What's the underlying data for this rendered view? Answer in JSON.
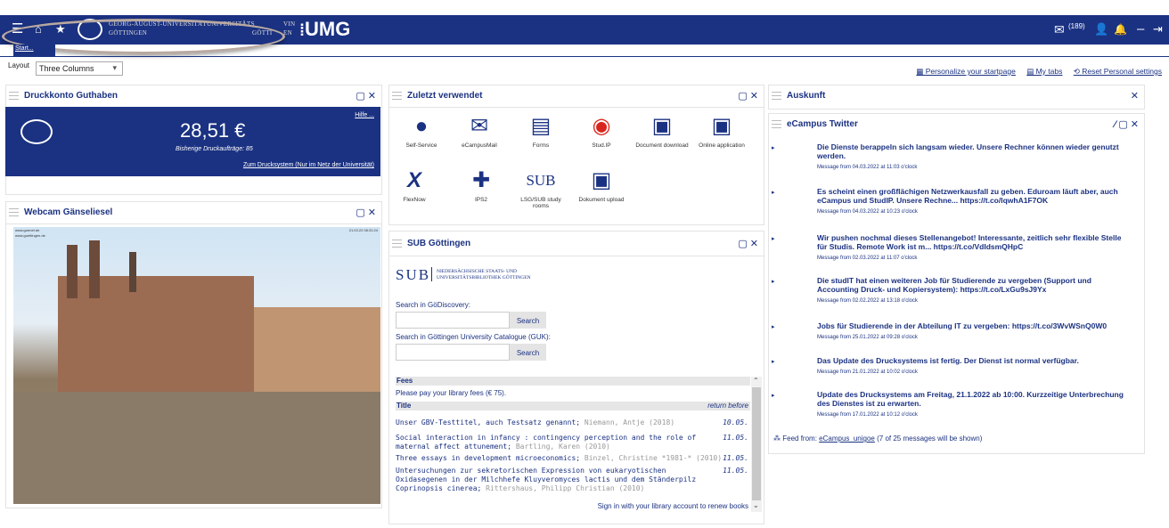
{
  "header": {
    "uni_line1": "GEORG-AUGUST-UNIVERSITÄT",
    "uni_line2": "GÖTTINGEN",
    "uni_right1": "UNIVERSITÄTS",
    "uni_right2": "GÖTTI",
    "uni_right3": "VIN",
    "uni_right4": "EN",
    "brand": "UMG",
    "mail_count": "(189)"
  },
  "tab": {
    "label": "Start..."
  },
  "layout": {
    "label": "Layout",
    "value": "Three Columns"
  },
  "links": {
    "personalize": "Personalize your startpage",
    "mytabs": "My tabs",
    "reset": "Reset Personal settings"
  },
  "druck": {
    "title": "Druckkonto Guthaben",
    "help": "Hilfe ...",
    "balance": "28,51 €",
    "jobs": "Bisherige Druckaufträge: 85",
    "link": "Zum Drucksystem (Nur im Netz der Universität)"
  },
  "webcam": {
    "title": "Webcam Gänseliesel",
    "tl1": "www.goenet.de",
    "tl2": "www.goettingen.de",
    "tr": "21.03.22 08:31:24"
  },
  "zuletzt": {
    "title": "Zuletzt verwendet",
    "items": [
      "Self-Service",
      "eCampusMail",
      "Forms",
      "Stud.IP",
      "Document download",
      "Online application",
      "FlexNow",
      "IPS2",
      "LSG/SUB study rooms",
      "Dokument upload"
    ]
  },
  "sub": {
    "title": "SUB Göttingen",
    "logo": "SUB",
    "logo_text1": "NIEDERSÄCHSISCHE STAATS- UND",
    "logo_text2": "UNIVERSITÄTSBIBLIOTHEK GÖTTINGEN",
    "search1_label": "Search in GöDiscovery:",
    "search2_label": "Search in Göttingen University Catalogue (GUK):",
    "search_btn": "Search",
    "fees_title": "Fees",
    "fees_text": "Please pay your library fees (€ 75).",
    "col_title": "Title",
    "col_return": "return before",
    "rows": [
      {
        "t": "Unser GBV-Testtitel, auch Testsatz genannt;",
        "a": " Niemann, Antje (2018)",
        "d": "10.05."
      },
      {
        "t": "Social interaction in infancy : contingency perception and the role of maternal affect attunement;",
        "a": " Bartling, Karen (2010)",
        "d": "11.05."
      },
      {
        "t": "Three essays in development microeconomics;",
        "a": " Binzel, Christine *1981-* (2010)",
        "d": "11.05."
      },
      {
        "t": "Untersuchungen zur sekretorischen Expression von eukaryotischen Oxidasegenen in der Milchhefe Kluyveromyces lactis und dem Ständerpilz Coprinopsis cinerea;",
        "a": " Rittershaus, Philipp Christian (2010)",
        "d": "11.05."
      }
    ],
    "signin": "Sign in with your library account to renew books"
  },
  "auskunft": {
    "title": "Auskunft"
  },
  "twitter": {
    "title": "eCampus Twitter",
    "items": [
      {
        "t": "Die Dienste berappeln sich langsam wieder. Unsere Rechner können wieder genutzt werden.",
        "m": "Message from 04.03.2022 at 11:03 o'clock"
      },
      {
        "t": "Es scheint einen großflächigen Netzwerkausfall zu geben. Eduroam läuft aber, auch eCampus und StudIP. Unsere Rechne... https://t.co/lqwhA1F7OK",
        "m": "Message from 04.03.2022 at 10:23 o'clock"
      },
      {
        "t": "Wir pushen nochmal dieses Stellenangebot! Interessante, zeitlich sehr flexible Stelle für Studis. Remote Work ist m... https://t.co/VdIdsmQHpC",
        "m": "Message from 02.03.2022 at 11:07 o'clock"
      },
      {
        "t": "Die studIT hat einen weiteren Job für Studierende zu vergeben (Support und Accounting Druck- und Kopiersystem): https://t.co/LxGu9sJ9Yx",
        "m": "Message from 02.02.2022 at 13:18 o'clock"
      },
      {
        "t": "Jobs für Studierende in der Abteilung IT zu vergeben: https://t.co/3WvWSnQ0W0",
        "m": "Message from 25.01.2022 at 09:28 o'clock"
      },
      {
        "t": "Das Update des Drucksystems ist fertig. Der Dienst ist normal verfügbar.",
        "m": "Message from 21.01.2022 at 10:02 o'clock"
      },
      {
        "t": "Update des Drucksystems am Freitag, 21.1.2022 ab 10:00. Kurzzeitige Unterbrechung des Dienstes ist zu erwarten.",
        "m": "Message from 17.01.2022 at 10:12 o'clock"
      }
    ],
    "feed_prefix": "Feed from:",
    "feed_link": "eCampus_unigoe",
    "feed_suffix": "(7 of 25 messages will be shown)"
  }
}
